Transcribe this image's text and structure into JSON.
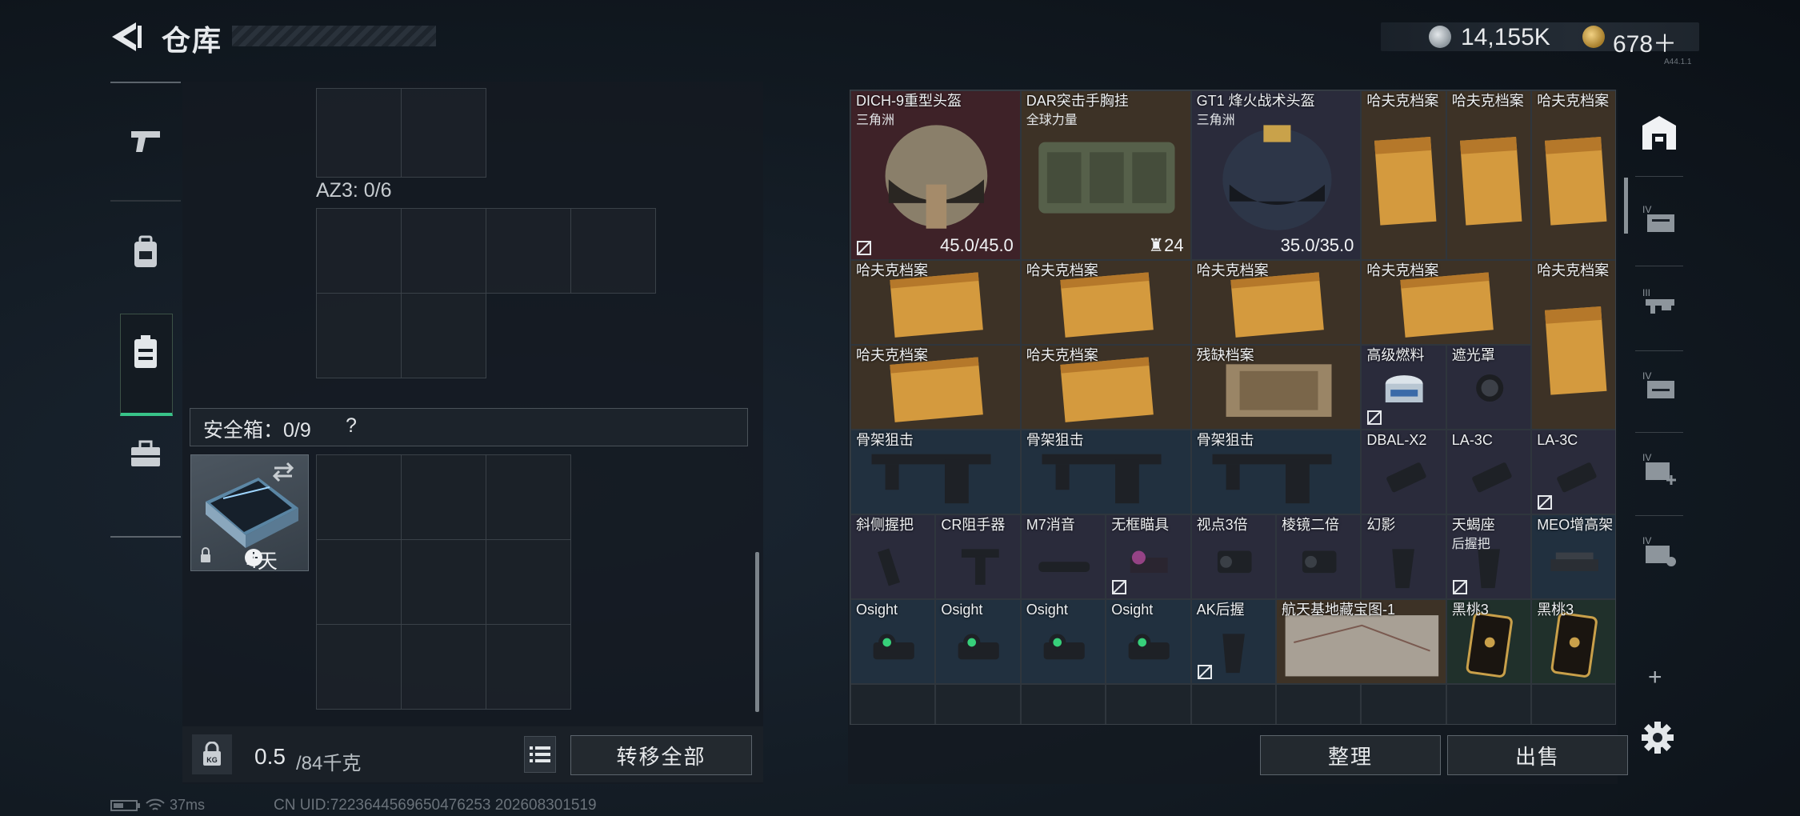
{
  "header": {
    "title": "仓库",
    "back_icon": "back-arrow-icon"
  },
  "currency": {
    "silver": "14,155K",
    "gold": "678＋",
    "tiny": "A44.1.1"
  },
  "left_nav": [
    {
      "icon": "pistol-icon"
    },
    {
      "icon": "backpack-icon"
    },
    {
      "icon": "chest-rig-icon",
      "active": true
    },
    {
      "icon": "briefcase-icon"
    }
  ],
  "container": {
    "az3_label": "AZ3: 0/6"
  },
  "safe_box": {
    "label": "安全箱：0/9",
    "help": "?",
    "days": "4天"
  },
  "weight": {
    "value": "0.5",
    "unit": "/84千克"
  },
  "buttons": {
    "transfer_all": "转移全部",
    "sort": "整理",
    "sell": "出售"
  },
  "stash_items": [
    {
      "id": "i0",
      "name": "DICH-9重型头盔",
      "sub": "三角洲",
      "durability": "45.0/45.0",
      "locked": true,
      "rarity": "red",
      "art": "helmet1"
    },
    {
      "id": "i1",
      "name": "DAR突击手胸挂",
      "sub": "全球力量",
      "count": "24",
      "rarity": "gold",
      "art": "rig"
    },
    {
      "id": "i2",
      "name": "GT1 烽火战术头盔",
      "sub": "三角洲",
      "durability": "35.0/35.0",
      "rarity": "purple",
      "art": "helmet2"
    },
    {
      "id": "i3",
      "name": "哈夫克档案",
      "rarity": "gold",
      "art": "file"
    },
    {
      "id": "i4",
      "name": "哈夫克档案",
      "rarity": "gold",
      "art": "file"
    },
    {
      "id": "i5",
      "name": "哈夫克档案",
      "rarity": "gold",
      "art": "file"
    },
    {
      "id": "i6",
      "name": "哈夫克档案",
      "rarity": "gold",
      "art": "fileh"
    },
    {
      "id": "i7",
      "name": "哈夫克档案",
      "rarity": "gold",
      "art": "fileh"
    },
    {
      "id": "i8",
      "name": "哈夫克档案",
      "rarity": "gold",
      "art": "fileh"
    },
    {
      "id": "i9",
      "name": "哈夫克档案",
      "rarity": "gold",
      "art": "fileh"
    },
    {
      "id": "i10",
      "name": "哈夫克档案",
      "rarity": "gold",
      "art": "file"
    },
    {
      "id": "i11",
      "name": "哈夫克档案",
      "rarity": "gold",
      "art": "fileh"
    },
    {
      "id": "i12",
      "name": "哈夫克档案",
      "rarity": "gold",
      "art": "fileh"
    },
    {
      "id": "i13",
      "name": "残缺档案",
      "rarity": "gold",
      "art": "scrap"
    },
    {
      "id": "i14",
      "name": "高级燃料",
      "locked": true,
      "rarity": "purple",
      "art": "fuel"
    },
    {
      "id": "i15",
      "name": "遮光罩",
      "rarity": "purple",
      "art": "hood"
    },
    {
      "id": "i16",
      "name": "骨架狙击",
      "rarity": "blue",
      "art": "stock"
    },
    {
      "id": "i17",
      "name": "骨架狙击",
      "rarity": "blue",
      "art": "stock"
    },
    {
      "id": "i18",
      "name": "骨架狙击",
      "rarity": "blue",
      "art": "stock"
    },
    {
      "id": "i19",
      "name": "DBAL-X2",
      "rarity": "purple",
      "art": "laser"
    },
    {
      "id": "i20",
      "name": "LA-3C",
      "rarity": "purple",
      "art": "laser"
    },
    {
      "id": "i21",
      "name": "LA-3C",
      "locked": true,
      "rarity": "purple",
      "art": "laser"
    },
    {
      "id": "i22",
      "name": "斜侧握把",
      "rarity": "purple",
      "art": "grip"
    },
    {
      "id": "i23",
      "name": "CR阻手器",
      "rarity": "purple",
      "art": "grip2"
    },
    {
      "id": "i24",
      "name": "M7消音",
      "rarity": "purple",
      "art": "supp"
    },
    {
      "id": "i25",
      "name": "无框瞄具",
      "locked": true,
      "rarity": "purple",
      "art": "holo"
    },
    {
      "id": "i26",
      "name": "视点3倍",
      "rarity": "purple",
      "art": "scope"
    },
    {
      "id": "i27",
      "name": "棱镜二倍",
      "rarity": "purple",
      "art": "scope"
    },
    {
      "id": "i28",
      "name": "幻影",
      "rarity": "purple",
      "art": "pgrip"
    },
    {
      "id": "i29",
      "name": "天蝎座",
      "sub": "后握把",
      "locked": true,
      "rarity": "purple",
      "art": "pgrip"
    },
    {
      "id": "i30",
      "name": "MEO增高架",
      "rarity": "blue",
      "art": "riser"
    },
    {
      "id": "i31",
      "name": "Osight",
      "rarity": "blue",
      "art": "osight"
    },
    {
      "id": "i32",
      "name": "Osight",
      "rarity": "blue",
      "art": "osight"
    },
    {
      "id": "i33",
      "name": "Osight",
      "rarity": "blue",
      "art": "osight"
    },
    {
      "id": "i34",
      "name": "Osight",
      "rarity": "blue",
      "art": "osight"
    },
    {
      "id": "i35",
      "name": "AK后握",
      "locked": true,
      "rarity": "blue",
      "art": "pgrip"
    },
    {
      "id": "i36",
      "name": "航天基地藏宝图-1",
      "rarity": "gold",
      "art": "map"
    },
    {
      "id": "i37",
      "name": "黑桃3",
      "rarity": "green",
      "art": "card"
    },
    {
      "id": "i38",
      "name": "黑桃3",
      "rarity": "green",
      "art": "card"
    }
  ],
  "right_toolbar": [
    {
      "icon": "stash-home-icon",
      "active": true
    },
    {
      "icon": "stash-tab-iv-1-icon"
    },
    {
      "icon": "stash-tab-iii-icon"
    },
    {
      "icon": "stash-tab-iv-2-icon"
    },
    {
      "icon": "stash-tab-iv-add-icon"
    },
    {
      "icon": "stash-tab-iv-lock-icon"
    }
  ],
  "status": {
    "ping": "37ms",
    "uid": "CN UID:7223644569650476253 202608301519"
  }
}
